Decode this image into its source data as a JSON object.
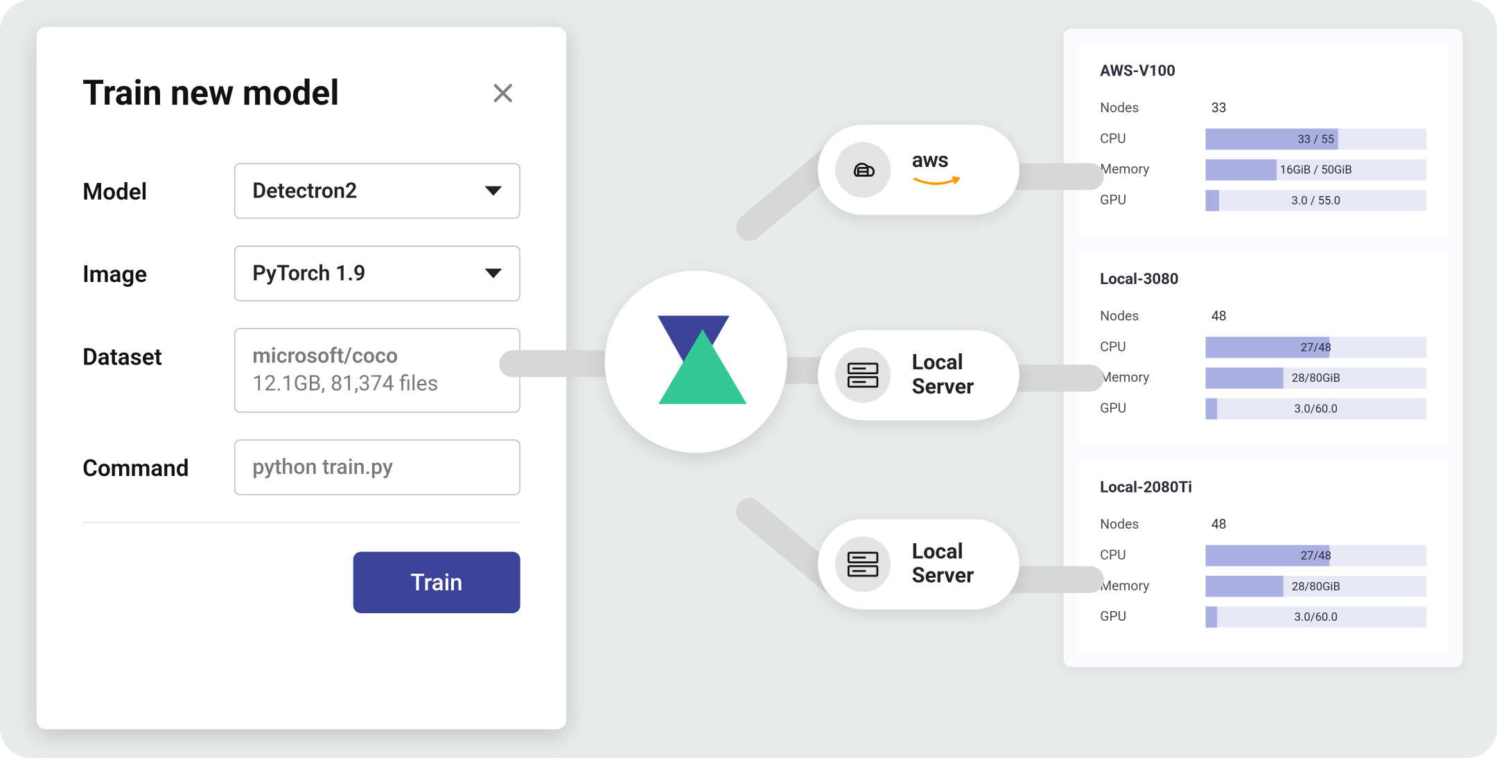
{
  "modal": {
    "title": "Train new model",
    "fields": {
      "model_label": "Model",
      "model_value": "Detectron2",
      "image_label": "Image",
      "image_value": "PyTorch 1.9",
      "dataset_label": "Dataset",
      "dataset_name": "microsoft/coco",
      "dataset_meta": "12.1GB, 81,374 files",
      "command_label": "Command",
      "command_value": "python train.py"
    },
    "train_button": "Train"
  },
  "targets": {
    "aws_label": "aws",
    "local1": "Local Server",
    "local2": "Local Server"
  },
  "resources": [
    {
      "name": "AWS-V100",
      "rows": {
        "nodes_label": "Nodes",
        "nodes_value": "33",
        "cpu_label": "CPU",
        "cpu_text": "33 / 55",
        "cpu_pct": 60,
        "mem_label": "Memory",
        "mem_text": "16GiB / 50GiB",
        "mem_pct": 32,
        "gpu_label": "GPU",
        "gpu_text": "3.0 / 55.0",
        "gpu_pct": 6
      }
    },
    {
      "name": "Local-3080",
      "rows": {
        "nodes_label": "Nodes",
        "nodes_value": "48",
        "cpu_label": "CPU",
        "cpu_text": "27/48",
        "cpu_pct": 56,
        "mem_label": "Memory",
        "mem_text": "28/80GiB",
        "mem_pct": 35,
        "gpu_label": "GPU",
        "gpu_text": "3.0/60.0",
        "gpu_pct": 5
      }
    },
    {
      "name": "Local-2080Ti",
      "rows": {
        "nodes_label": "Nodes",
        "nodes_value": "48",
        "cpu_label": "CPU",
        "cpu_text": "27/48",
        "cpu_pct": 56,
        "mem_label": "Memory",
        "mem_text": "28/80GiB",
        "mem_pct": 35,
        "gpu_label": "GPU",
        "gpu_text": "3.0/60.0",
        "gpu_pct": 5
      }
    }
  ],
  "chart_data": [
    {
      "type": "bar",
      "title": "AWS-V100",
      "series": [
        {
          "name": "CPU",
          "value": 33,
          "max": 55
        },
        {
          "name": "Memory",
          "value": 16,
          "max": 50,
          "unit": "GiB"
        },
        {
          "name": "GPU",
          "value": 3.0,
          "max": 55.0
        }
      ],
      "nodes": 33
    },
    {
      "type": "bar",
      "title": "Local-3080",
      "series": [
        {
          "name": "CPU",
          "value": 27,
          "max": 48
        },
        {
          "name": "Memory",
          "value": 28,
          "max": 80,
          "unit": "GiB"
        },
        {
          "name": "GPU",
          "value": 3.0,
          "max": 60.0
        }
      ],
      "nodes": 48
    },
    {
      "type": "bar",
      "title": "Local-2080Ti",
      "series": [
        {
          "name": "CPU",
          "value": 27,
          "max": 48
        },
        {
          "name": "Memory",
          "value": 28,
          "max": 80,
          "unit": "GiB"
        },
        {
          "name": "GPU",
          "value": 3.0,
          "max": 60.0
        }
      ],
      "nodes": 48
    }
  ]
}
